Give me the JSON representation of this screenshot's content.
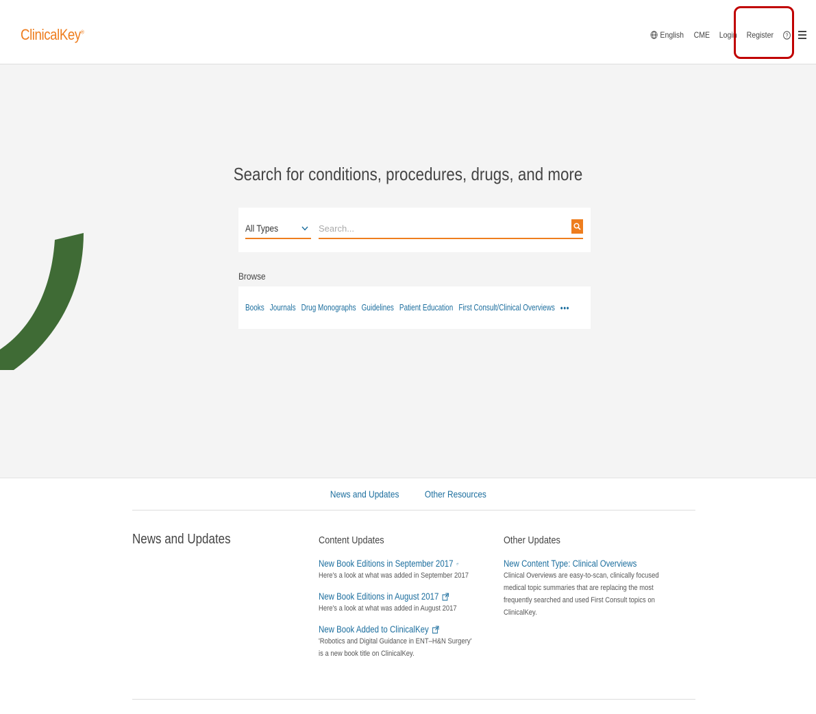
{
  "header": {
    "logo": "ClinicalKey",
    "logo_mark": "®",
    "nav": {
      "language": "English",
      "cme": "CME",
      "login": "Login",
      "register": "Register"
    }
  },
  "hero": {
    "title": "Search for conditions, procedures, drugs, and more",
    "type_select": "All Types",
    "search_placeholder": "Search...",
    "browse_label": "Browse",
    "browse_links": [
      "Books",
      "Journals",
      "Drug Monographs",
      "Guidelines",
      "Patient Education",
      "First Consult/Clinical Overviews"
    ],
    "more": "•••"
  },
  "footer": {
    "tabs": [
      "News and Updates",
      "Other Resources"
    ],
    "section_heading": "News and Updates",
    "content_updates": {
      "title": "Content Updates",
      "entries": [
        {
          "link": "New Book Editions in September 2017",
          "desc": "Here's a look at what was added in September 2017"
        },
        {
          "link": "New Book Editions in August 2017",
          "desc": "Here's a look at what was added in August 2017"
        },
        {
          "link": "New Book Added to ClinicalKey",
          "desc": "'Robotics and Digital Guidance in ENT–H&N Surgery' is a new book title on ClinicalKey."
        }
      ]
    },
    "other_updates": {
      "title": "Other Updates",
      "entries": [
        {
          "link": "New Content Type: Clinical Overviews",
          "desc": "Clinical Overviews are easy-to-scan, clinically focused medical topic summaries that are replacing the most frequently searched and used First Consult topics on ClinicalKey."
        }
      ]
    }
  },
  "colors": {
    "brand_orange": "#ee7d1e",
    "link_blue": "#1c6e9e",
    "highlight_red": "#c00000",
    "arrow_green": "#3f6b35"
  }
}
